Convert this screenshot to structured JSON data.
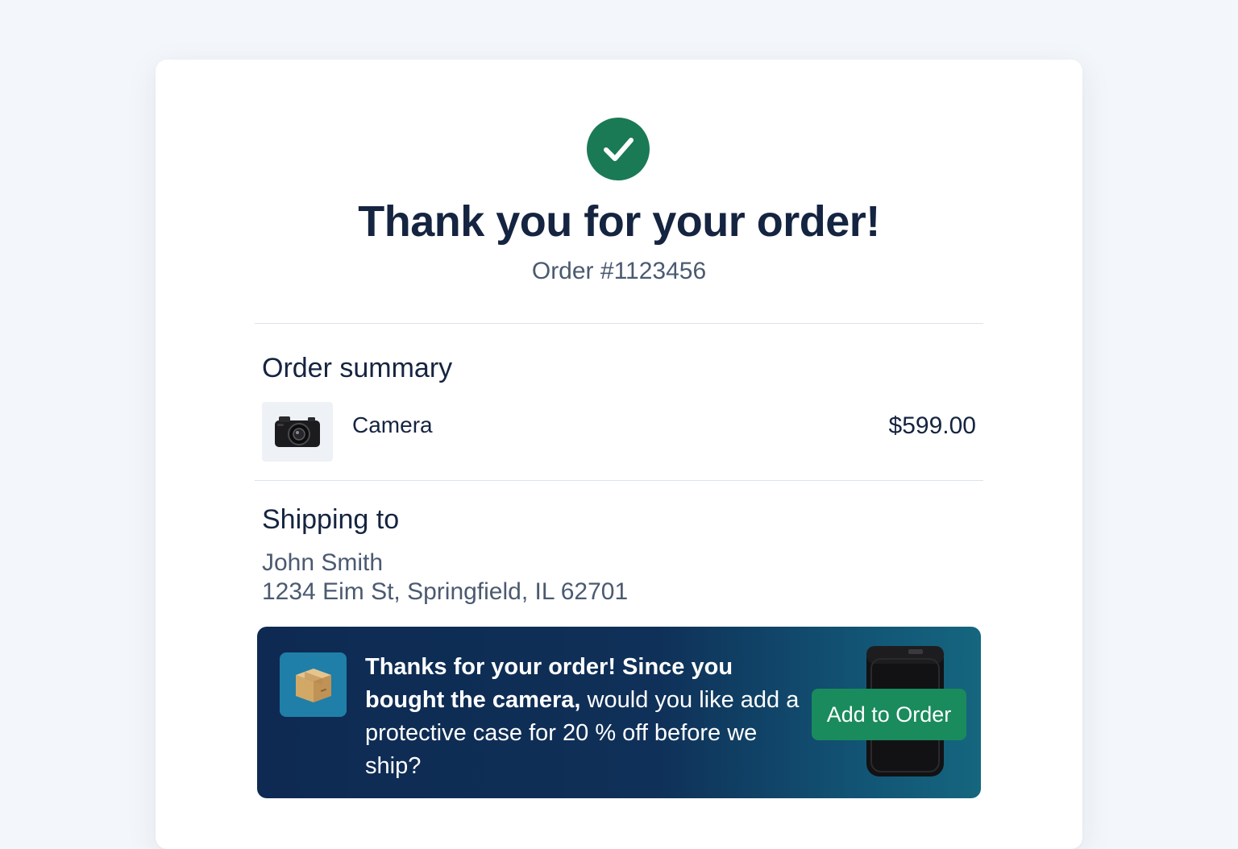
{
  "header": {
    "title": "Thank you for your order!",
    "order_number": "Order #1123456"
  },
  "summary": {
    "heading": "Order summary",
    "items": [
      {
        "name": "Camera",
        "price": "$599.00",
        "icon": "camera-icon"
      }
    ]
  },
  "shipping": {
    "heading": "Shipping to",
    "name": "John Smith",
    "address": "1234 Eim St, Springfield, IL 62701"
  },
  "upsell": {
    "text_bold": "Thanks for your order! Since you bought the camera,",
    "text_rest": " would you like add a protective case for 20 % off before we ship?",
    "button_label": "Add to Order",
    "icon": "package-icon",
    "product_image": "protective-case"
  },
  "colors": {
    "success": "#1a7a55",
    "heading_text": "#152440",
    "muted_text": "#4b5a70",
    "banner_bg": "#0e2a52",
    "button_bg": "#1a8b5c"
  }
}
